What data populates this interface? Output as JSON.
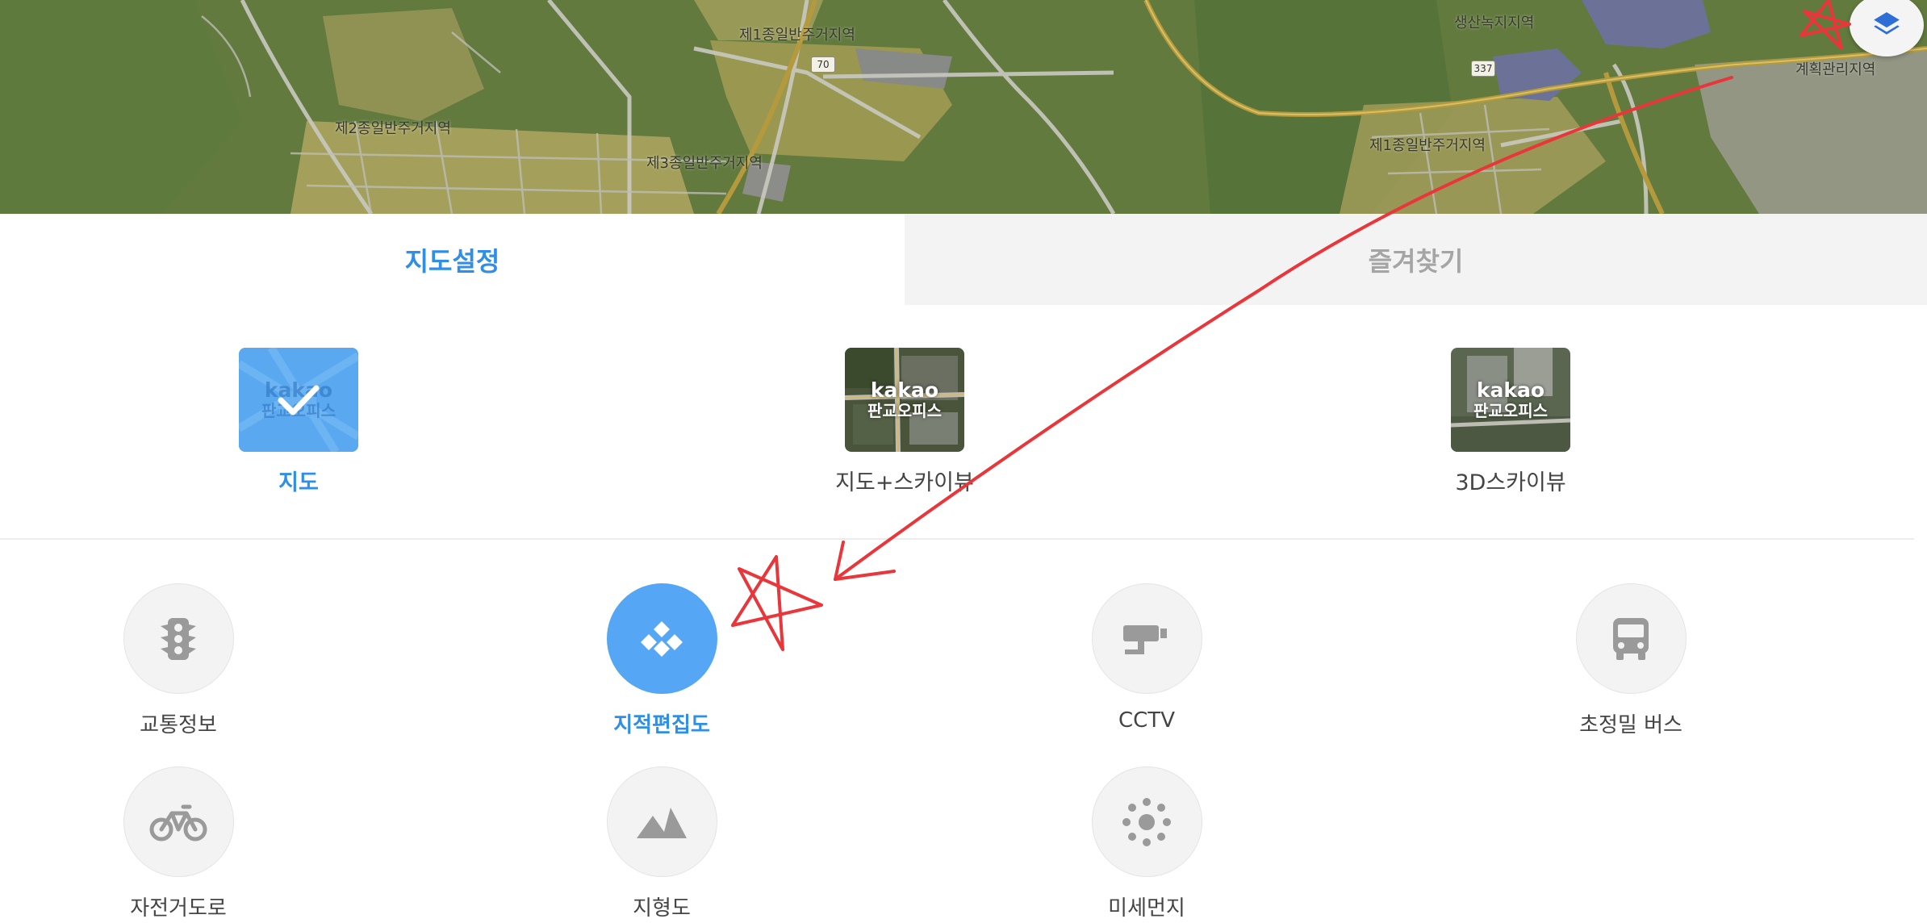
{
  "map": {
    "labels": {
      "zone_1": "제1종일반주거지역",
      "zone_2": "제2종일반주거지역",
      "zone_3": "제3종일반주거지역",
      "zone_4": "제1종일반주거지역",
      "green": "생산녹지지역",
      "planning": "계획관리지역"
    },
    "road_shields": [
      "70",
      "337"
    ],
    "layer_button_icon": "layers-icon"
  },
  "tabs": {
    "map_settings": "지도설정",
    "favorites": "즐겨찾기"
  },
  "map_types": {
    "thumb_brand": "kakao",
    "thumb_sub": "판교오피스",
    "items": [
      {
        "label": "지도",
        "selected": true
      },
      {
        "label": "지도+스카이뷰",
        "selected": false
      },
      {
        "label": "3D스카이뷰",
        "selected": false
      }
    ]
  },
  "layers": [
    {
      "label": "교통정보",
      "icon": "traffic-light-icon",
      "active": false
    },
    {
      "label": "지적편집도",
      "icon": "cadastral-icon",
      "active": true
    },
    {
      "label": "CCTV",
      "icon": "cctv-icon",
      "active": false
    },
    {
      "label": "초정밀 버스",
      "icon": "bus-icon",
      "active": false
    },
    {
      "label": "자전거도로",
      "icon": "bicycle-icon",
      "active": false
    },
    {
      "label": "지형도",
      "icon": "mountain-icon",
      "active": false
    },
    {
      "label": "미세먼지",
      "icon": "dust-icon",
      "active": false
    }
  ],
  "colors": {
    "accent": "#2f8fe6",
    "active_circle": "#55a6f4",
    "annotation": "#e8363b"
  }
}
